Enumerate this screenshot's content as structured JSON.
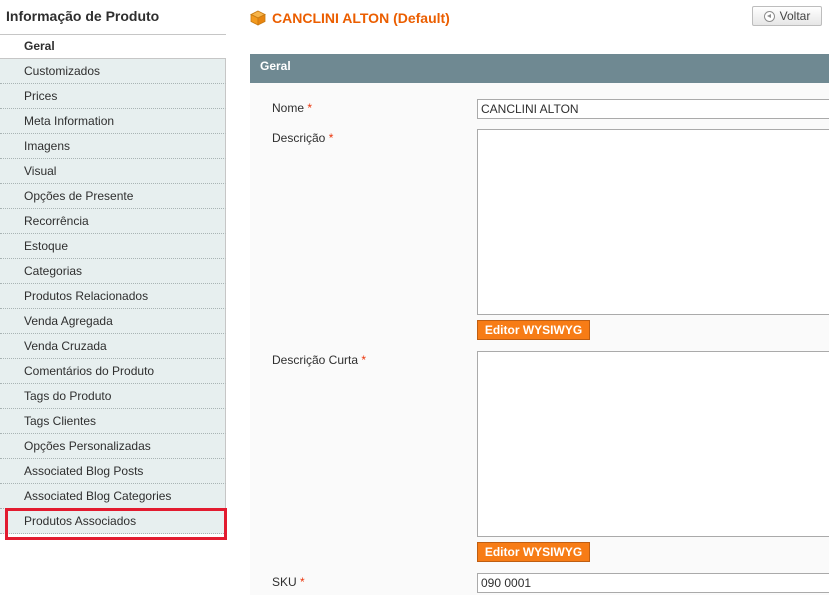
{
  "sidebar": {
    "title": "Informação de Produto",
    "tabs": [
      {
        "label": "Geral",
        "active": true
      },
      {
        "label": "Customizados"
      },
      {
        "label": "Prices"
      },
      {
        "label": "Meta Information"
      },
      {
        "label": "Imagens"
      },
      {
        "label": "Visual"
      },
      {
        "label": "Opções de Presente"
      },
      {
        "label": "Recorrência"
      },
      {
        "label": "Estoque"
      },
      {
        "label": "Categorias"
      },
      {
        "label": "Produtos Relacionados"
      },
      {
        "label": "Venda Agregada"
      },
      {
        "label": "Venda Cruzada"
      },
      {
        "label": "Comentários do Produto"
      },
      {
        "label": "Tags do Produto"
      },
      {
        "label": "Tags Clientes"
      },
      {
        "label": "Opções Personalizadas"
      },
      {
        "label": "Associated Blog Posts"
      },
      {
        "label": "Associated Blog Categories"
      },
      {
        "label": "Produtos Associados",
        "highlighted": true
      }
    ]
  },
  "header": {
    "title": "CANCLINI ALTON (Default)",
    "back_label": "Voltar"
  },
  "section": {
    "title": "Geral"
  },
  "form": {
    "name_label": "Nome",
    "name_value": "CANCLINI ALTON",
    "description_label": "Descrição",
    "short_description_label": "Descrição Curta",
    "wysiwyg_label": "Editor WYSIWYG",
    "sku_label": "SKU",
    "sku_value": "090 0001",
    "required_mark": "*"
  },
  "colors": {
    "accent": "#eb5e00",
    "section_header": "#6f8992",
    "tab_bg": "#e7efef",
    "highlight": "#e21b2f",
    "button": "#f77c16"
  }
}
